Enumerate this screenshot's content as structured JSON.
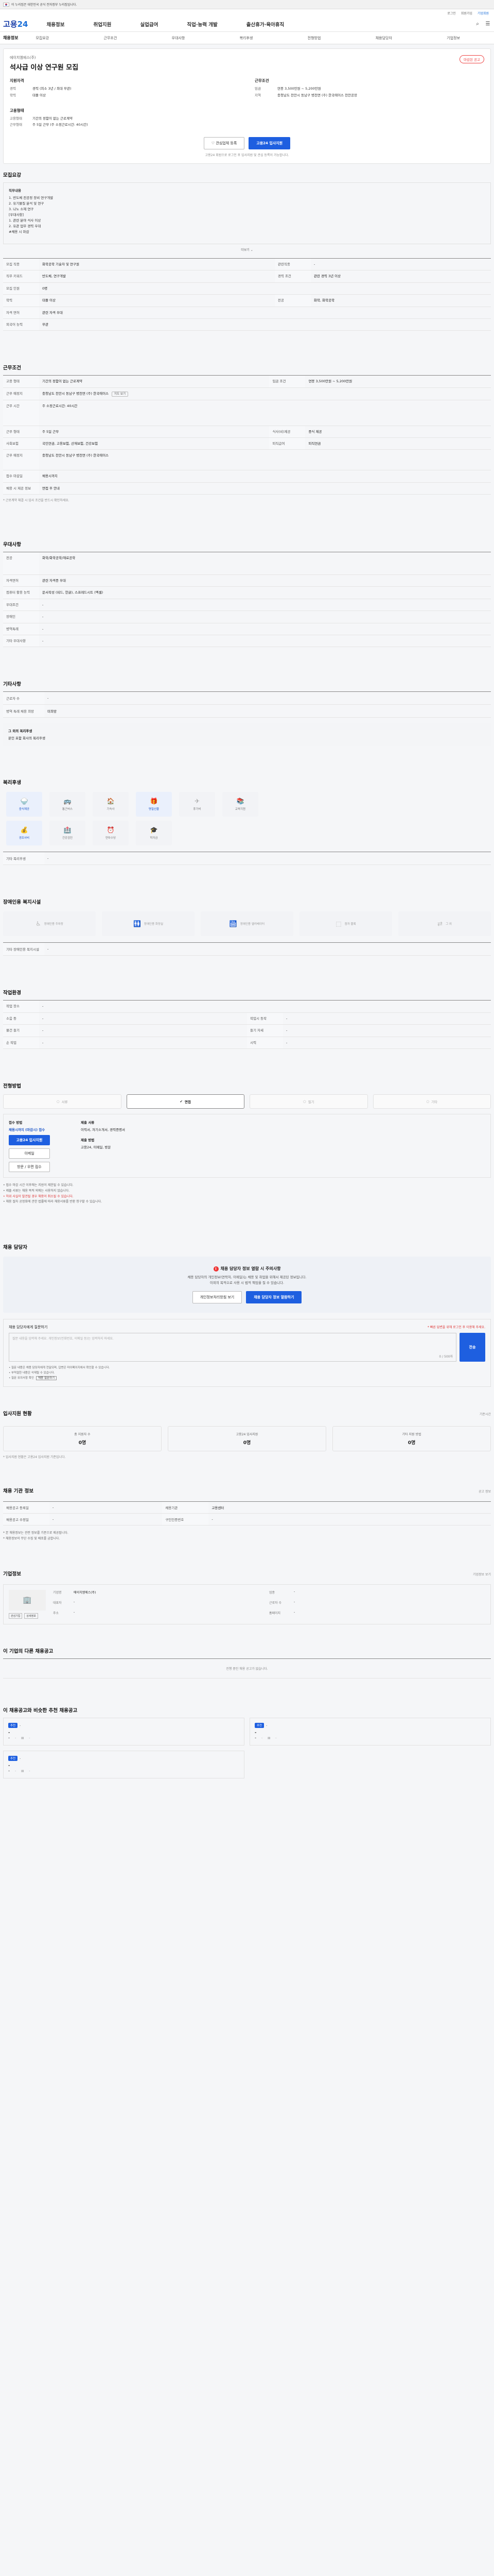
{
  "gov_banner": "이 누리집은 대한민국 공식 전자정부 누리집입니다.",
  "util_links": [
    "로그인",
    "회원가입",
    "기업회원"
  ],
  "logo": {
    "main": "고용",
    "sub": "24"
  },
  "gnb": [
    "채용정보",
    "취업지원",
    "실업급여",
    "직업·능력 개발",
    "출산휴가·육아휴직"
  ],
  "subnav": {
    "title": "채용정보",
    "tabs": [
      "모집요강",
      "근무조건",
      "우대사항",
      "복리후생",
      "전형방법",
      "채용담당자",
      "기업정보"
    ]
  },
  "summary": {
    "company": "에이치엠에스(주)",
    "title": "석사급 이상 연구원 모집",
    "badge": "마감된 공고",
    "qual_head": "지원자격",
    "qual": [
      {
        "k": "경력",
        "v": "경력 (최소 3년 / 최대 무관)"
      },
      {
        "k": "학력",
        "v": "대졸 이상"
      }
    ],
    "cond_head": "근무조건",
    "cond": [
      {
        "k": "임금",
        "v": "연봉 3,500만원 ~ 5,200만원"
      },
      {
        "k": "지역",
        "v": "충청남도 천안시 동남구 병천면 (주) 한국에이스 천안공장"
      }
    ],
    "emp_head": "고용형태",
    "emp": [
      {
        "k": "고용형태",
        "v": "기간의 정함이 없는 근로계약"
      },
      {
        "k": "근무형태",
        "v": "주 5일 근무 (주 소정근로시간: 40시간)"
      }
    ],
    "btn_scrap": "관심업체 등록",
    "btn_apply": "고용24 입사지원",
    "btn_note": "고용24 회원으로 로그인 후 입사지원 및 관심 등록이 가능합니다."
  },
  "recruit": {
    "head": "모집요강",
    "body": [
      "직무내용",
      "1. 반도체 전공정 장비 연구개발",
      "2. 유기물질 분석 및 연구",
      "3. 나노 소재 연구",
      "",
      "[우대사항]",
      "1. 관련 분야 석사 이상",
      "2. 유관 업무 경력 우대",
      "",
      "#채용 시 마감"
    ],
    "more": "더보기 ⌄",
    "rows": [
      {
        "k": "모집 직종",
        "v": "화학공학 기술자 및 연구원",
        "k2": "관련직종",
        "v2": "-"
      },
      {
        "k": "직무 키워드",
        "v": "반도체, 연구개발",
        "k2": "경력 조건",
        "v2": "관련 경력 3년 이상"
      },
      {
        "k": "모집 인원",
        "v": "0명",
        "k2": "",
        "v2": ""
      },
      {
        "k": "학력",
        "v": "대졸 이상",
        "k2": "전공",
        "v2": "화학, 화학공학"
      },
      {
        "k": "자격 면허",
        "v": "관련 자격 우대",
        "k2": "",
        "v2": ""
      },
      {
        "k": "외국어 능력",
        "v": "무관",
        "k2": "",
        "v2": ""
      }
    ]
  },
  "work": {
    "head": "근무조건",
    "rows": [
      {
        "k": "고용 형태",
        "v": "기간의 정함이 없는 근로계약",
        "k2": "임금 조건",
        "v2": "연봉 3,500만원 ~ 5,200만원"
      },
      {
        "k": "근무 예정지",
        "v": "충청남도 천안시 동남구 병천면 (주) 한국에이스",
        "k2": "",
        "v2": ""
      },
      {
        "k": "근무 시간",
        "v": "주 소정근로시간: 40시간",
        "k2": "",
        "v2": ""
      },
      {
        "k": "근무 형태",
        "v": "주 5일 근무",
        "k2": "식사(비)제공",
        "v2": "중식 제공"
      },
      {
        "k": "사회보험",
        "v": "국민연금, 고용보험, 산재보험, 건강보험",
        "k2": "퇴직급여",
        "v2": "퇴직연금"
      },
      {
        "k": "근무 예정지",
        "v": "충청남도 천안시 동남구 병천면 (주) 한국에이스",
        "k2": "",
        "v2": ""
      },
      {
        "k": "접수 마감일",
        "v": "채용시까지",
        "k2": "",
        "v2": ""
      },
      {
        "k": "채용 시 제공 정보",
        "v": "면접 후 안내",
        "k2": "",
        "v2": ""
      }
    ],
    "map_btn": "지도 보기",
    "note": "* 근로계약 체결 시 입사 조건을 반드시 확인하세요."
  },
  "prefer": {
    "head": "우대사항",
    "rows": [
      {
        "k": "전공",
        "v": "화학/화학공학/재료공학"
      },
      {
        "k": "자격면허",
        "v": "관련 자격증 우대"
      },
      {
        "k": "컴퓨터 활용 능력",
        "v": "문서작성 (워드, 한글), 스프레드시트 (엑셀)"
      },
      {
        "k": "우대조건",
        "v": "-"
      },
      {
        "k": "장애인",
        "v": "-"
      },
      {
        "k": "병역특례",
        "v": "-"
      },
      {
        "k": "기타 우대사항",
        "v": "-"
      }
    ]
  },
  "other": {
    "head": "기타사항",
    "rows": [
      {
        "k": "근로자 수",
        "v": "-"
      },
      {
        "k": "병역 특례 채용 희망",
        "v": "미희망"
      }
    ],
    "box_head": "그 외의 복리후생",
    "box_body": "본인 포함 회사의 복리후생"
  },
  "benefits": {
    "head": "복리후생",
    "items": [
      {
        "ico": "🍚",
        "label": "중식제공",
        "on": true
      },
      {
        "ico": "🚌",
        "label": "통근버스",
        "on": false
      },
      {
        "ico": "🏠",
        "label": "기숙사",
        "on": false
      },
      {
        "ico": "🎁",
        "label": "명절선물",
        "on": true
      },
      {
        "ico": "✈",
        "label": "휴가비",
        "on": false
      },
      {
        "ico": "📚",
        "label": "교육지원",
        "on": false
      },
      {
        "ico": "💰",
        "label": "경조사비",
        "on": true
      },
      {
        "ico": "🏥",
        "label": "건강검진",
        "on": false
      },
      {
        "ico": "⏰",
        "label": "연차수당",
        "on": false
      },
      {
        "ico": "🎓",
        "label": "학자금",
        "on": false
      }
    ],
    "label2": "기타 복리후생",
    "value2": "-"
  },
  "facility": {
    "head": "장애인용 복지시설",
    "items": [
      {
        "ico": "♿",
        "label": "장애인용 주차장"
      },
      {
        "ico": "🚻",
        "label": "장애인용 화장실"
      },
      {
        "ico": "🛗",
        "label": "장애인용 엘리베이터"
      },
      {
        "ico": "⬚",
        "label": "점자 블록"
      },
      {
        "ico": "⇄",
        "label": "그 외"
      }
    ],
    "label2": "기타 장애인용 복지시설",
    "value2": "-"
  },
  "env": {
    "head": "작업환경",
    "rows": [
      {
        "k": "작업 장소",
        "v": "-",
        "k2": "",
        "v2": ""
      },
      {
        "k": "소음 등",
        "v": "-",
        "k2": "작업시 동작",
        "v2": "-"
      },
      {
        "k": "물건 들기",
        "v": "-",
        "k2": "들기 자세",
        "v2": "-"
      },
      {
        "k": "손 작업",
        "v": "-",
        "k2": "시력",
        "v2": "-"
      }
    ]
  },
  "process": {
    "head": "전형방법",
    "steps": [
      {
        "label": "서류",
        "on": false
      },
      {
        "label": "면접",
        "on": true
      },
      {
        "label": "필기",
        "on": false
      },
      {
        "label": "기타",
        "on": false
      }
    ],
    "apply_head": "접수 방법",
    "apply_sub": "채용시까지 (마감시) 접수",
    "apply_btn1": "고용24 입사지원",
    "apply_btn2": "이메일",
    "apply_btn3": "방문 / 우편 접수",
    "docs_head": "제출 서류",
    "docs": "이력서, 자기소개서, 경력증명서",
    "method_head": "제출 방법",
    "method": "고용24, 이메일, 방문",
    "bullets": [
      "• 접수 마감 시간 이후에는 지원이 제한될 수 있습니다.",
      "• 제출 서류는 채용 목적 외에는 사용하지 않습니다.",
      "• 허위 사실이 발견될 경우 채용이 취소될 수 있습니다.",
      "• 채용 절차 공정화에 관한 법률에 따라 채용서류를 반환 청구할 수 있습니다."
    ]
  },
  "hr": {
    "head": "채용 담당자",
    "warn": "채용 담당자 정보 열람 시 주의사항",
    "p1": "채용 담당자의 개인정보(연락처, 이메일)는 채용 및 취업을 위해서 제공된 정보입니다.",
    "p2": "이외의 목적으로 사용 시 법적 책임을 질 수 있습니다.",
    "btn1": "개인정보처리방침 보기",
    "btn2": "채용 담당자 정보 열람하기"
  },
  "question": {
    "head": "채용 담당자에게 질문하기",
    "warn": "* 빠른 답변을 위해 로그인 후 이용해 주세요.",
    "placeholder": "질문 내용을 입력해 주세요. 개인정보(전화번호, 이메일 등)는 입력하지 마세요.",
    "count": "0 / 500자",
    "send": "전송",
    "notes": [
      "• 질문 내용은 채용 담당자에게 전달되며, 답변은 마이페이지에서 확인할 수 있습니다.",
      "• 부적절한 내용은 삭제될 수 있습니다.",
      "• 질문 유의사항 확인"
    ],
    "note_btn": "채용 질문하기"
  },
  "apply_status": {
    "head": "입사지원 현황",
    "right": "기준시간",
    "stats": [
      {
        "lbl": "총 지원자 수",
        "val": "0명"
      },
      {
        "lbl": "고용24 입사지원",
        "val": "0명"
      },
      {
        "lbl": "기타 지원 방법",
        "val": "0명"
      }
    ],
    "note": "* 입사지원 현황은 고용24 입사지원 기준입니다."
  },
  "post_info": {
    "head": "채용 기관 정보",
    "right": "공고 정보",
    "rows": [
      {
        "k": "채용공고 등록일",
        "v": "-",
        "k2": "채용기관",
        "v2": "고용센터"
      },
      {
        "k": "채용공고 수정일",
        "v": "-",
        "k2": "구인인증번호",
        "v2": "-"
      }
    ],
    "notes": [
      "* 본 채용정보는 관련 정보를 기준으로 제공됩니다.",
      "* 채용정보의 무단 수집 및 배포를 금합니다."
    ]
  },
  "company_info": {
    "head": "기업정보",
    "right": "기업정보 보기",
    "logo": "🏢",
    "actions": [
      "관심기업",
      "상세정보"
    ],
    "rows": [
      {
        "k": "기업명",
        "v": "에이치엠에스(주)",
        "k2": "업종",
        "v2": "-"
      },
      {
        "k": "대표자",
        "v": "-",
        "k2": "근로자 수",
        "v2": "-"
      },
      {
        "k": "주소",
        "v": "-",
        "k2": "홈페이지",
        "v2": "-"
      }
    ]
  },
  "same_company": {
    "head": "이 기업의 다른 채용공고",
    "empty": "진행 중인 채용 공고가 없습니다."
  },
  "recommend": {
    "head": "이 채용공고와 비슷한 추천 채용공고",
    "items": [
      {
        "tag": "추천",
        "cname": "-",
        "title": "-",
        "meta": [
          "-",
          "-"
        ]
      },
      {
        "tag": "추천",
        "cname": "-",
        "title": "-",
        "meta": [
          "-",
          "-"
        ]
      },
      {
        "tag": "추천",
        "cname": "-",
        "title": "-",
        "meta": [
          "-",
          "-"
        ]
      }
    ]
  }
}
